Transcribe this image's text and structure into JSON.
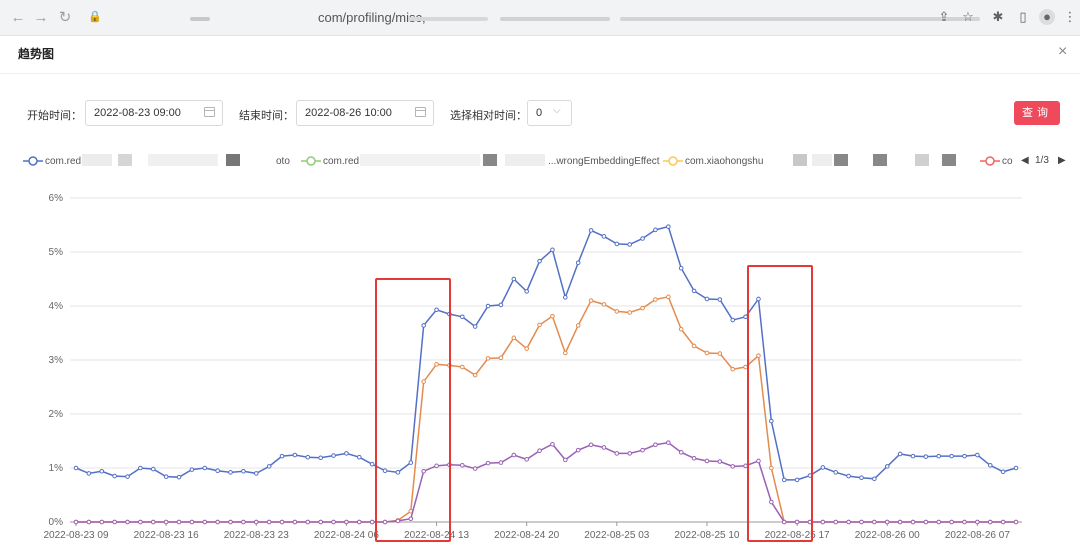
{
  "browser": {
    "url_text": "com/profiling/misc,",
    "back_icon": "arrow-left-icon",
    "forward_icon": "arrow-right-icon",
    "reload_icon": "reload-icon"
  },
  "dialog": {
    "title": "趋势图",
    "close_label": "×"
  },
  "filters": {
    "start_label": "开始时间：",
    "start_value": "2022-08-23 09:00",
    "end_label": "结束时间：",
    "end_value": "2022-08-26 10:00",
    "relative_label": "选择相对时间：",
    "relative_value": "0",
    "query_label": "查询"
  },
  "legend": {
    "items": [
      {
        "label": "com.red",
        "suffix": "oto",
        "color": "#5470c6"
      },
      {
        "label": "com.red",
        "suffix": "...wrongEmbeddingEffect",
        "color": "#91cc75"
      },
      {
        "label": "com.xiaohongshu",
        "suffix": "",
        "color": "#fac858"
      },
      {
        "label": "co",
        "suffix": "",
        "color": "#ee6666"
      }
    ],
    "page": "1/3"
  },
  "colors": {
    "accent": "#ef4a5c",
    "highlight": "#e53935"
  },
  "chart_data": {
    "type": "line",
    "ylim": [
      0,
      6
    ],
    "y_ticks": [
      "0%",
      "1%",
      "2%",
      "3%",
      "4%",
      "5%",
      "6%"
    ],
    "x_ticks": [
      "2022-08-23 09",
      "2022-08-23 16",
      "2022-08-23 23",
      "2022-08-24 06",
      "2022-08-24 13",
      "2022-08-24 20",
      "2022-08-25 03",
      "2022-08-25 10",
      "2022-08-25 17",
      "2022-08-26 00",
      "2022-08-26 07"
    ],
    "grid": true,
    "series": [
      {
        "color": "#5470c6",
        "values": [
          1.0,
          0.9,
          0.94,
          0.85,
          0.84,
          1.0,
          0.98,
          0.84,
          0.83,
          0.97,
          1.0,
          0.95,
          0.92,
          0.94,
          0.9,
          1.03,
          1.22,
          1.24,
          1.2,
          1.19,
          1.23,
          1.27,
          1.2,
          1.07,
          0.95,
          0.92,
          1.1,
          3.64,
          3.93,
          3.85,
          3.8,
          3.62,
          4.0,
          4.02,
          4.5,
          4.27,
          4.83,
          5.04,
          4.16,
          4.8,
          5.4,
          5.29,
          5.15,
          5.14,
          5.25,
          5.41,
          5.47,
          4.7,
          4.28,
          4.13,
          4.12,
          3.74,
          3.8,
          4.13,
          1.87,
          0.78,
          0.78,
          0.86,
          1.01,
          0.92,
          0.85,
          0.82,
          0.8,
          1.03,
          1.26,
          1.22,
          1.21,
          1.22,
          1.22,
          1.22,
          1.24,
          1.05,
          0.93,
          1.0
        ]
      },
      {
        "color": "#e38b4f",
        "values": [
          0,
          0,
          0,
          0,
          0,
          0,
          0,
          0,
          0,
          0,
          0,
          0,
          0,
          0,
          0,
          0,
          0,
          0,
          0,
          0,
          0,
          0,
          0,
          0,
          0,
          0.03,
          0.2,
          2.6,
          2.92,
          2.9,
          2.87,
          2.72,
          3.03,
          3.04,
          3.41,
          3.21,
          3.65,
          3.81,
          3.13,
          3.64,
          4.1,
          4.03,
          3.9,
          3.88,
          3.96,
          4.12,
          4.17,
          3.57,
          3.26,
          3.13,
          3.12,
          2.83,
          2.87,
          3.08,
          1.0,
          0.0,
          0,
          0,
          0,
          0,
          0,
          0,
          0,
          0,
          0,
          0,
          0,
          0,
          0,
          0,
          0,
          0,
          0,
          0
        ]
      },
      {
        "color": "#9a60b4",
        "values": [
          0,
          0,
          0,
          0,
          0,
          0,
          0,
          0,
          0,
          0,
          0,
          0,
          0,
          0,
          0,
          0,
          0,
          0,
          0,
          0,
          0,
          0,
          0,
          0,
          0,
          0.02,
          0.06,
          0.94,
          1.04,
          1.06,
          1.05,
          0.99,
          1.09,
          1.1,
          1.24,
          1.16,
          1.32,
          1.44,
          1.15,
          1.33,
          1.43,
          1.38,
          1.27,
          1.27,
          1.33,
          1.43,
          1.47,
          1.29,
          1.18,
          1.13,
          1.12,
          1.03,
          1.04,
          1.13,
          0.37,
          0.0,
          0,
          0,
          0,
          0,
          0,
          0,
          0,
          0,
          0,
          0,
          0,
          0,
          0,
          0,
          0,
          0,
          0,
          0
        ]
      }
    ]
  }
}
